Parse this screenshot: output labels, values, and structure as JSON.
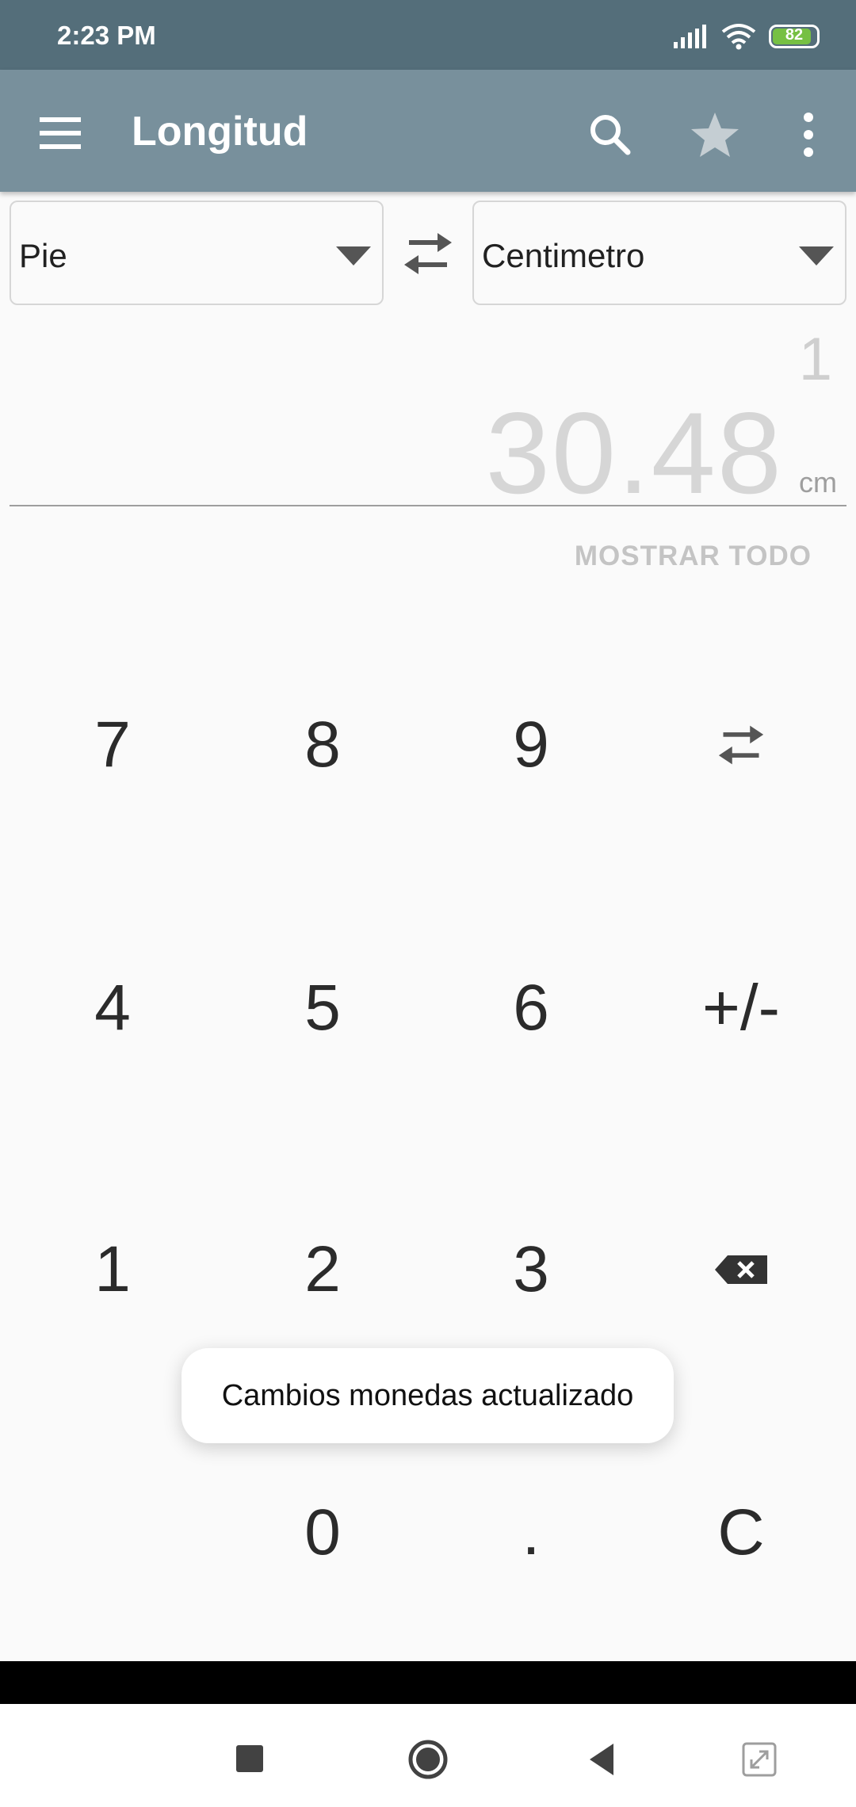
{
  "status_bar": {
    "time": "2:23 PM",
    "battery": "82"
  },
  "app_bar": {
    "title": "Longitud"
  },
  "converter": {
    "from_unit": "Pie",
    "to_unit": "Centimetro",
    "input_value": "1",
    "result_value": "30.48",
    "result_unit": "cm",
    "show_all_label": "MOSTRAR TODO"
  },
  "keypad": {
    "k7": "7",
    "k8": "8",
    "k9": "9",
    "k4": "4",
    "k5": "5",
    "k6": "6",
    "plus_minus": "+/-",
    "k1": "1",
    "k2": "2",
    "k3": "3",
    "k0": "0",
    "dot": ".",
    "clear": "C"
  },
  "toast": {
    "message": "Cambios monedas actualizado"
  },
  "colors": {
    "status_bar": "#546e7a",
    "app_bar": "#78909c",
    "battery": "#76c043"
  }
}
